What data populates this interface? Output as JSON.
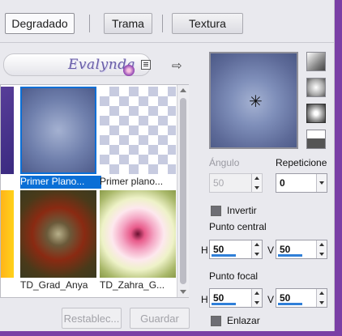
{
  "tabs": [
    {
      "label": "Degradado",
      "active": true
    },
    {
      "label": "Trama",
      "active": false
    },
    {
      "label": "Textura",
      "active": false
    }
  ],
  "library": {
    "watermark": "Evalynda",
    "items": [
      {
        "caption": "Primer Plano...",
        "selected": true
      },
      {
        "caption": "Primer plano...",
        "selected": false
      },
      {
        "caption": "TD_Grad_Anya",
        "selected": false
      },
      {
        "caption": "TD_Zahra_G...",
        "selected": false
      }
    ]
  },
  "buttons": {
    "reset": "Restablec...",
    "save": "Guardar"
  },
  "angle": {
    "label": "Ángulo",
    "value": "50"
  },
  "repeats": {
    "label": "Repeticione",
    "value": "0"
  },
  "invert": {
    "label": "Invertir"
  },
  "center": {
    "label": "Punto central",
    "h_label": "H",
    "h": "50",
    "v_label": "V",
    "v": "50"
  },
  "focal": {
    "label": "Punto focal",
    "h_label": "H",
    "h": "50",
    "v_label": "V",
    "v": "50"
  },
  "link": {
    "label": "Enlazar"
  },
  "preview_colors": {
    "center": "#a5b2d2",
    "edge": "#4c5a87"
  }
}
